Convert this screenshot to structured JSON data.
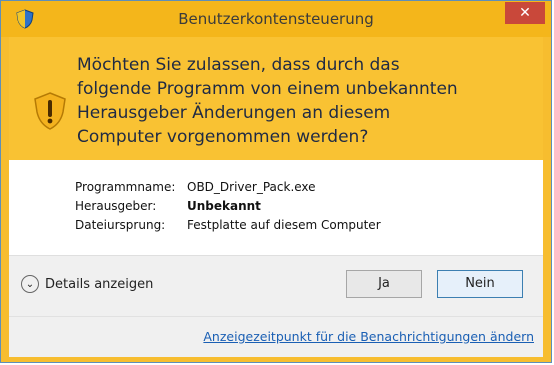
{
  "window": {
    "title": "Benutzerkontensteuerung"
  },
  "banner": {
    "question": "Möchten Sie zulassen, dass durch das folgende Programm von einem unbekannten Herausgeber Änderungen an diesem Computer vorgenommen werden?"
  },
  "details": {
    "program_label": "Programmname:",
    "program_value": "OBD_Driver_Pack.exe",
    "publisher_label": "Herausgeber:",
    "publisher_value": "Unbekannt",
    "origin_label": "Dateiursprung:",
    "origin_value": "Festplatte auf diesem Computer"
  },
  "footer": {
    "details_toggle": "Details anzeigen",
    "yes_label": "Ja",
    "no_label": "Nein",
    "notification_link": "Anzeigezeitpunkt für die Benachrichtigungen ändern"
  },
  "colors": {
    "titlebar": "#f4b61b",
    "banner": "#f9c233",
    "close": "#c9483a",
    "link": "#1a5fb4"
  },
  "icons": {
    "app": "uac-shield-icon",
    "warning": "warning-shield-icon",
    "close": "close-icon",
    "toggle": "chevron-down-icon"
  }
}
